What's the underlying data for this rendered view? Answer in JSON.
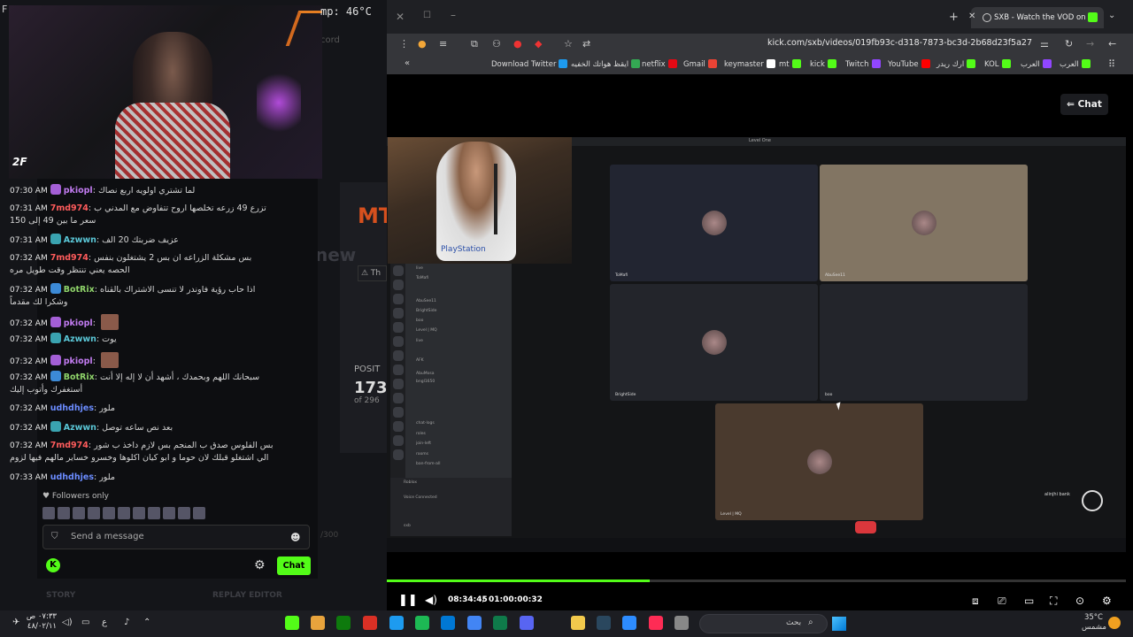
{
  "stream_overlay": {
    "temp_text": "mp: 46°C",
    "top_letter": "F",
    "cam_logo": "2F",
    "ghost_cord": "cord",
    "ghost_mt": "MT",
    "ghost_new": "new",
    "ghost_th": "⚠ Th",
    "ghost_posit": "POSIT",
    "ghost_173": "173",
    "ghost_of": "of 296",
    "ghost_300": "/300"
  },
  "chat": {
    "messages": [
      {
        "time": "07:30 AM",
        "user": "pkiopl",
        "color": "#c17bf0",
        "badge": "#a45fd6",
        "text": "لما تشتري اولويه اربع نصاك"
      },
      {
        "time": "07:31 AM",
        "user": "7md974",
        "color": "#ff5c5c",
        "badge": "",
        "text": "تزرع 49 زرعه تخلصها اروح تتفاوض مع المدني ب سعر ما بين 49 إلى 150"
      },
      {
        "time": "07:31 AM",
        "user": "Azwwn",
        "color": "#5ac6d6",
        "badge": "#3aa3b0",
        "text": "عزيف ضربتك 20 الف"
      },
      {
        "time": "07:32 AM",
        "user": "7md974",
        "color": "#ff5c5c",
        "badge": "",
        "text": "بس مشكلة الزراعه ان بس 2 يشتغلون بنفس الحصه يعني تنتظر وقت طويل مره"
      },
      {
        "time": "07:32 AM",
        "user": "BotRix",
        "color": "#8fd46a",
        "badge": "#3c8ad6",
        "text": "اذا حاب رؤية فاوندر لا تنسى الاشتراك بالقناه وشكرا لك مقدماً"
      },
      {
        "time": "07:32 AM",
        "user": "pkiopl",
        "color": "#c17bf0",
        "badge": "#a45fd6",
        "text": ""
      },
      {
        "time": "07:32 AM",
        "user": "Azwwn",
        "color": "#5ac6d6",
        "badge": "#3aa3b0",
        "text": "يوت"
      },
      {
        "time": "07:32 AM",
        "user": "pkiopl",
        "color": "#c17bf0",
        "badge": "#a45fd6",
        "text": ""
      },
      {
        "time": "07:32 AM",
        "user": "BotRix",
        "color": "#8fd46a",
        "badge": "#3c8ad6",
        "text": "سبحانك اللهم وبحمدك ، أشهد أن لا إله إلا أنت أستغفرك وأتوب إليك"
      },
      {
        "time": "07:32 AM",
        "user": "udhdhjes",
        "color": "#6b8cff",
        "badge": "",
        "text": "ملور"
      },
      {
        "time": "07:32 AM",
        "user": "Azwwn",
        "color": "#5ac6d6",
        "badge": "#3aa3b0",
        "text": "بعد نص ساعه توصل"
      },
      {
        "time": "07:32 AM",
        "user": "7md974",
        "color": "#ff5c5c",
        "badge": "",
        "text": "بس الفلوس صدق ب المنجم بس لازم داخذ ب شور الي اشتغلو قبلك لان حوما و ابو كيان اكلوها وخسرو خساير مالهم فيها لزوم"
      },
      {
        "time": "07:33 AM",
        "user": "udhdhjes",
        "color": "#6b8cff",
        "badge": "",
        "text": "ملور"
      }
    ],
    "followers_only": "♥ Followers only",
    "send_placeholder": "Send a message",
    "chat_button": "Chat",
    "story": "STORY",
    "replay": "REPLAY EDITOR"
  },
  "browser": {
    "tab_title": "SXB - Watch the VOD on Ki",
    "url": "kick.com/sxb/videos/019fb93c-d318-7873-bc3d-2b68d23f5a27",
    "bookmarks": [
      {
        "label": "Download Twitter",
        "color": "#1d9bf0"
      },
      {
        "label": "ايقظ هواتك الخفيه",
        "color": "#34a853"
      },
      {
        "label": "netflix",
        "color": "#e50914"
      },
      {
        "label": "Gmail",
        "color": "#ea4335"
      },
      {
        "label": "keymaster",
        "color": "#ffffff"
      },
      {
        "label": "mt",
        "color": "#53fc18"
      },
      {
        "label": "kick",
        "color": "#53fc18"
      },
      {
        "label": "Twitch",
        "color": "#9146ff"
      },
      {
        "label": "YouTube",
        "color": "#ff0000"
      },
      {
        "label": "ارك ريدر",
        "color": "#53fc18"
      },
      {
        "label": "KOL",
        "color": "#53fc18"
      },
      {
        "label": "العرب",
        "color": "#9146ff"
      },
      {
        "label": "العرب",
        "color": "#53fc18"
      }
    ],
    "chat_toggle": "⇐ Chat"
  },
  "video": {
    "window_title": "Level One",
    "tiles": [
      {
        "name": "ToMafi",
        "bg": "#222531"
      },
      {
        "name": "AbuSee11",
        "bg": "#827563"
      },
      {
        "name": "BrightSide",
        "bg": "#23252b"
      },
      {
        "name": "boo",
        "bg": "#23252b"
      },
      {
        "name": "Level | MQ",
        "bg": "#4a3a2e"
      }
    ],
    "discord_labels": [
      "live",
      "ToMafi",
      "AbuSee11",
      "BrightSide",
      "boo",
      "Level | MQ",
      "live",
      "AFK",
      "AbuMosa",
      "bngl1650",
      "chat-logs",
      "roles",
      "join-left",
      "rooms",
      "ban-from-all",
      "Roblox",
      "Voice Connected",
      "sxb"
    ],
    "cam_brand": "PlayStation",
    "bank_label": "alinjhi bank"
  },
  "player": {
    "current_time": "08:34:45",
    "separator": "/",
    "total_time": "01:00:00:32",
    "progress_fraction": 0.356
  },
  "taskbar": {
    "time": "٠٧:٣٣ ص",
    "date": "٤٨/٠٢/١١",
    "lang": "ع",
    "search_placeholder": "بحث",
    "temperature": "35°C",
    "weather": "مشمس"
  }
}
